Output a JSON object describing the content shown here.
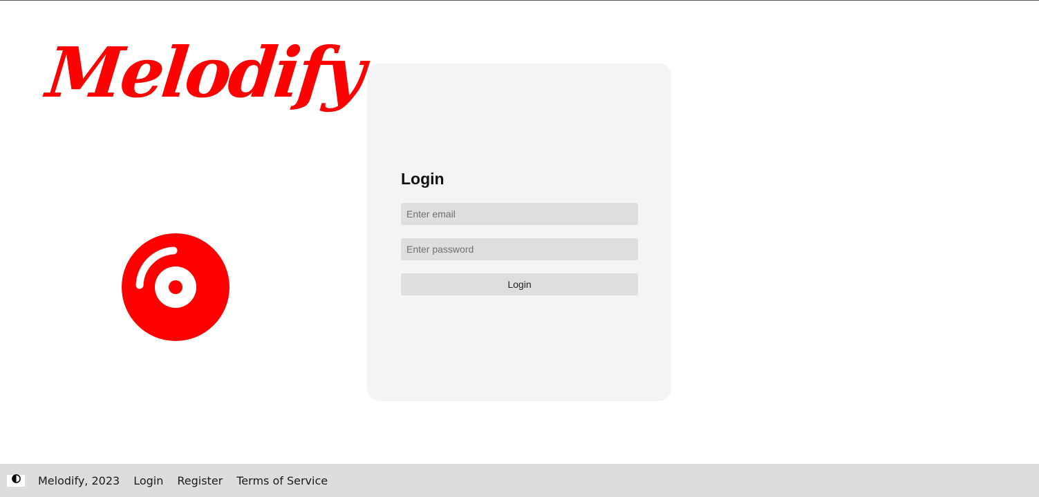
{
  "brand": {
    "name": "Melodify",
    "color": "#ff0000"
  },
  "icons": {
    "disc": "disc-icon",
    "theme": "contrast-icon"
  },
  "login_card": {
    "title": "Login",
    "email_placeholder": "Enter email",
    "password_placeholder": "Enter password",
    "submit_label": "Login"
  },
  "footer": {
    "copyright": "Melodify, 2023",
    "links": [
      "Login",
      "Register",
      "Terms of Service"
    ]
  }
}
